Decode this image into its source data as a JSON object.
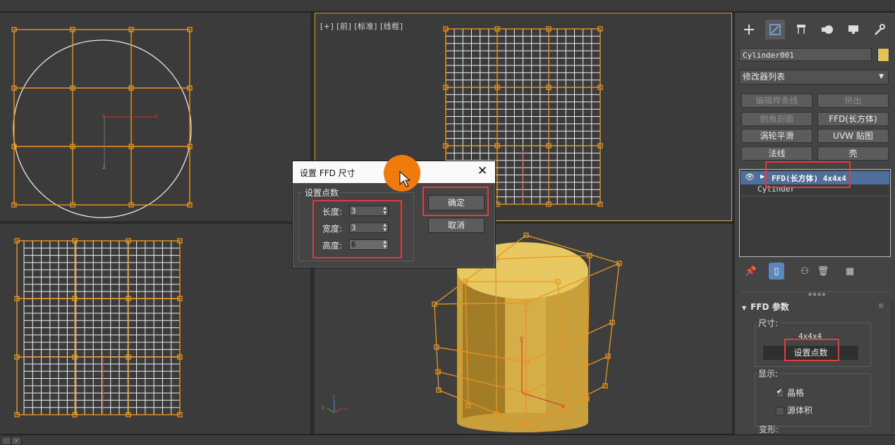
{
  "viewports": {
    "front_label": "[+] [前] [标准] [线框]"
  },
  "command_panel": {
    "tabs": [
      "create-icon",
      "modify-icon",
      "hierarchy-icon",
      "motion-icon",
      "display-icon",
      "utilities-icon"
    ],
    "object_name": "Cylinder001",
    "object_color": "#e2c25a",
    "modifier_list_label": "修改器列表",
    "modifier_buttons": [
      {
        "label": "编辑样条线",
        "enabled": false
      },
      {
        "label": "挤出",
        "enabled": false
      },
      {
        "label": "倒角剖面",
        "enabled": false
      },
      {
        "label": "FFD(长方体)",
        "enabled": true
      },
      {
        "label": "涡轮平滑",
        "enabled": true
      },
      {
        "label": "UVW 贴图",
        "enabled": true
      },
      {
        "label": "法线",
        "enabled": true
      },
      {
        "label": "壳",
        "enabled": true
      }
    ],
    "stack": {
      "selected": "FFD(长方体) 4x4x4",
      "base": "Cylinder"
    },
    "rollout": {
      "title": "FFD 参数",
      "dims_group": "尺寸:",
      "dims_value": "4x4x4",
      "set_points_button": "设置点数",
      "display_group": "显示:",
      "lattice_label": "晶格",
      "lattice_checked": true,
      "source_volume_label": "源体积",
      "source_volume_checked": false,
      "cut_label": "变形:"
    }
  },
  "dialog": {
    "title": "设置 FFD 尺寸",
    "group_title": "设置点数",
    "length_label": "长度:",
    "length_value": "3",
    "width_label": "宽度:",
    "width_value": "3",
    "height_label": "高度:",
    "height_value": "6",
    "ok_label": "确定",
    "cancel_label": "取消"
  },
  "colors": {
    "lattice": "#e8961e",
    "highlight": "#e33b3b",
    "cursor": "#f17a0d",
    "cylinder": "#d9b24a"
  }
}
